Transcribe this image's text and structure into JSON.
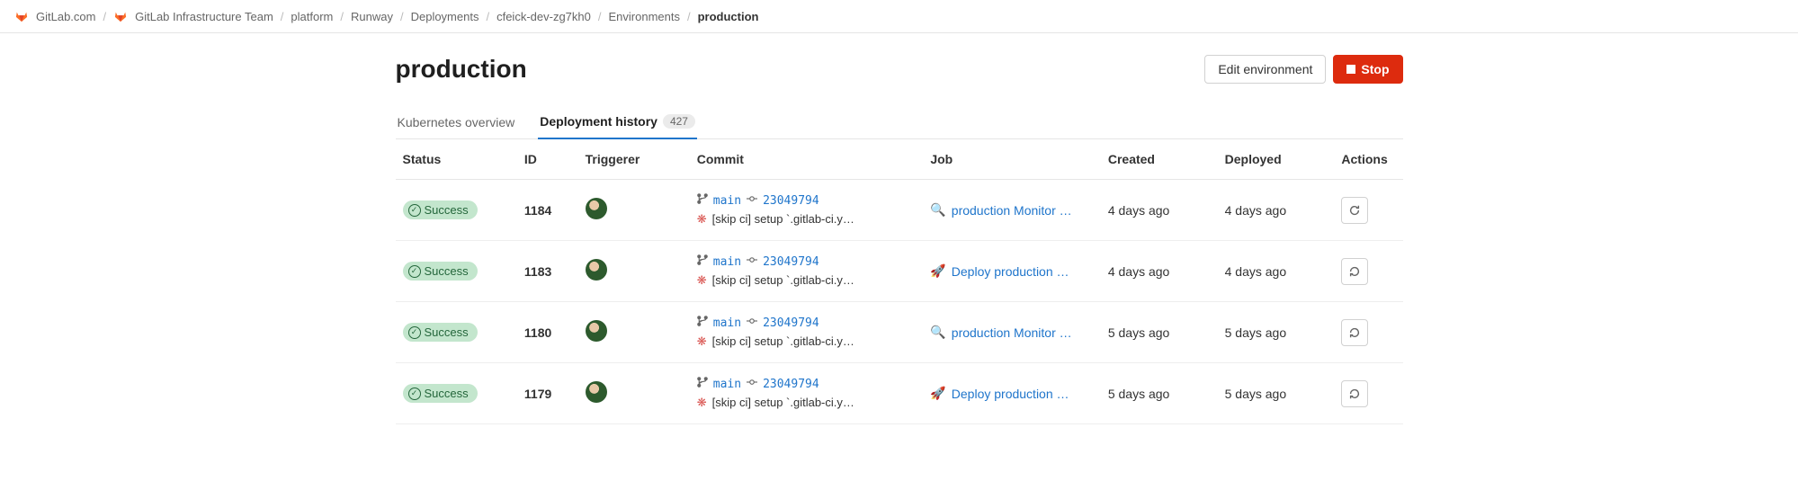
{
  "breadcrumbs": [
    {
      "label": "GitLab.com",
      "icon": "gitlab"
    },
    {
      "label": "GitLab Infrastructure Team",
      "icon": "gitlab"
    },
    {
      "label": "platform"
    },
    {
      "label": "Runway"
    },
    {
      "label": "Deployments"
    },
    {
      "label": "cfeick-dev-zg7kh0"
    },
    {
      "label": "Environments"
    },
    {
      "label": "production",
      "current": true
    }
  ],
  "page_title": "production",
  "actions": {
    "edit_label": "Edit environment",
    "stop_label": "Stop"
  },
  "tabs": {
    "kubernetes": "Kubernetes overview",
    "history": "Deployment history",
    "history_count": "427"
  },
  "columns": {
    "status": "Status",
    "id": "ID",
    "triggerer": "Triggerer",
    "commit": "Commit",
    "job": "Job",
    "created": "Created",
    "deployed": "Deployed",
    "actions": "Actions"
  },
  "status_label": "Success",
  "deployments": [
    {
      "id": "1184",
      "branch": "main",
      "sha": "23049794",
      "msg": "[skip ci] setup `.gitlab-ci.y…",
      "job_icon": "magnify",
      "job": "production Monitor …",
      "created": "4 days ago",
      "deployed": "4 days ago",
      "action_icon": "refresh"
    },
    {
      "id": "1183",
      "branch": "main",
      "sha": "23049794",
      "msg": "[skip ci] setup `.gitlab-ci.y…",
      "job_icon": "rocket",
      "job": "Deploy production (…",
      "created": "4 days ago",
      "deployed": "4 days ago",
      "action_icon": "rollback"
    },
    {
      "id": "1180",
      "branch": "main",
      "sha": "23049794",
      "msg": "[skip ci] setup `.gitlab-ci.y…",
      "job_icon": "magnify",
      "job": "production Monitor …",
      "created": "5 days ago",
      "deployed": "5 days ago",
      "action_icon": "rollback"
    },
    {
      "id": "1179",
      "branch": "main",
      "sha": "23049794",
      "msg": "[skip ci] setup `.gitlab-ci.y…",
      "job_icon": "rocket",
      "job": "Deploy production (…",
      "created": "5 days ago",
      "deployed": "5 days ago",
      "action_icon": "rollback"
    }
  ]
}
